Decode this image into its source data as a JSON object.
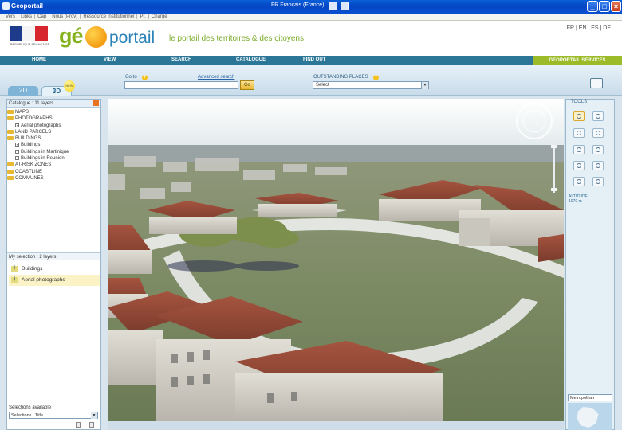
{
  "window": {
    "title": "Geoportail",
    "lang_box": "FR Français (France)"
  },
  "browser": {
    "address_text": "Vers │ Links │ Cap │ Nous (Prov) │ Ressource Institutionnel │ Pr. │ Charge"
  },
  "header": {
    "rf_text": "RÉPUBLIQUE FRANÇAISE",
    "logo_geo": "gé",
    "logo_portail": "portail",
    "tagline": "le portail des territoires & des citoyens",
    "langs": "FR | EN | ES | DE"
  },
  "nav": {
    "items": [
      "HOME",
      "VIEW",
      "SEARCH",
      "CATALOGUE",
      "FIND OUT"
    ],
    "services": "GEOPORTAIL SERVICES"
  },
  "search": {
    "tab_2d": "2D",
    "tab_3d": "3D",
    "bulb_text": "NEW",
    "go_label": "Go to",
    "advanced_link": "Advanced search",
    "go_button": "Go",
    "places_label": "OUTSTANDING PLACES",
    "places_value": "Select",
    "help": "?"
  },
  "catalogue": {
    "title": "Catalogue : 11 layers",
    "tree": [
      {
        "type": "folder",
        "label": "MAPS",
        "level": 0
      },
      {
        "type": "folder",
        "label": "PHOTOGRAPHS",
        "level": 0
      },
      {
        "type": "check",
        "label": "Aerial photographs",
        "level": 1,
        "checked": true
      },
      {
        "type": "folder",
        "label": "LAND PARCELS",
        "level": 0
      },
      {
        "type": "folder",
        "label": "BUILDINGS",
        "level": 0
      },
      {
        "type": "check",
        "label": "Buildings",
        "level": 1,
        "checked": true
      },
      {
        "type": "check",
        "label": "Buildings in Martinique",
        "level": 1,
        "checked": false
      },
      {
        "type": "check",
        "label": "Buildings in Reunion",
        "level": 1,
        "checked": false
      },
      {
        "type": "folder",
        "label": "AT-RISK ZONES",
        "level": 0
      },
      {
        "type": "folder",
        "label": "COASTLINE",
        "level": 0
      },
      {
        "type": "folder",
        "label": "COMMUNES",
        "level": 0
      }
    ]
  },
  "selection": {
    "title": "My selection : 2 layers",
    "items": [
      "Buildings",
      "Aerial photographs"
    ]
  },
  "selections_available": {
    "label": "Selections available",
    "value": "Selections : Title"
  },
  "tools": {
    "label": "TOOLS",
    "altitude_label": "ALTITUDE",
    "altitude_value": "1079 m",
    "region_select": "Metropolitan"
  }
}
